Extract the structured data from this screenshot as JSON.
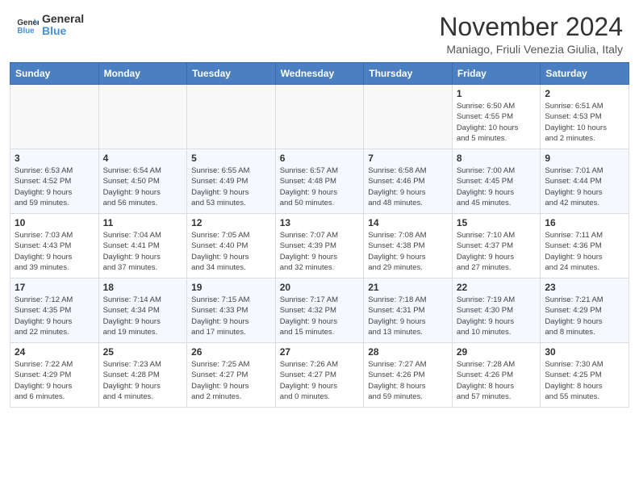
{
  "header": {
    "logo_line1": "General",
    "logo_line2": "Blue",
    "month_title": "November 2024",
    "subtitle": "Maniago, Friuli Venezia Giulia, Italy"
  },
  "weekdays": [
    "Sunday",
    "Monday",
    "Tuesday",
    "Wednesday",
    "Thursday",
    "Friday",
    "Saturday"
  ],
  "weeks": [
    [
      {
        "day": "",
        "info": ""
      },
      {
        "day": "",
        "info": ""
      },
      {
        "day": "",
        "info": ""
      },
      {
        "day": "",
        "info": ""
      },
      {
        "day": "",
        "info": ""
      },
      {
        "day": "1",
        "info": "Sunrise: 6:50 AM\nSunset: 4:55 PM\nDaylight: 10 hours\nand 5 minutes."
      },
      {
        "day": "2",
        "info": "Sunrise: 6:51 AM\nSunset: 4:53 PM\nDaylight: 10 hours\nand 2 minutes."
      }
    ],
    [
      {
        "day": "3",
        "info": "Sunrise: 6:53 AM\nSunset: 4:52 PM\nDaylight: 9 hours\nand 59 minutes."
      },
      {
        "day": "4",
        "info": "Sunrise: 6:54 AM\nSunset: 4:50 PM\nDaylight: 9 hours\nand 56 minutes."
      },
      {
        "day": "5",
        "info": "Sunrise: 6:55 AM\nSunset: 4:49 PM\nDaylight: 9 hours\nand 53 minutes."
      },
      {
        "day": "6",
        "info": "Sunrise: 6:57 AM\nSunset: 4:48 PM\nDaylight: 9 hours\nand 50 minutes."
      },
      {
        "day": "7",
        "info": "Sunrise: 6:58 AM\nSunset: 4:46 PM\nDaylight: 9 hours\nand 48 minutes."
      },
      {
        "day": "8",
        "info": "Sunrise: 7:00 AM\nSunset: 4:45 PM\nDaylight: 9 hours\nand 45 minutes."
      },
      {
        "day": "9",
        "info": "Sunrise: 7:01 AM\nSunset: 4:44 PM\nDaylight: 9 hours\nand 42 minutes."
      }
    ],
    [
      {
        "day": "10",
        "info": "Sunrise: 7:03 AM\nSunset: 4:43 PM\nDaylight: 9 hours\nand 39 minutes."
      },
      {
        "day": "11",
        "info": "Sunrise: 7:04 AM\nSunset: 4:41 PM\nDaylight: 9 hours\nand 37 minutes."
      },
      {
        "day": "12",
        "info": "Sunrise: 7:05 AM\nSunset: 4:40 PM\nDaylight: 9 hours\nand 34 minutes."
      },
      {
        "day": "13",
        "info": "Sunrise: 7:07 AM\nSunset: 4:39 PM\nDaylight: 9 hours\nand 32 minutes."
      },
      {
        "day": "14",
        "info": "Sunrise: 7:08 AM\nSunset: 4:38 PM\nDaylight: 9 hours\nand 29 minutes."
      },
      {
        "day": "15",
        "info": "Sunrise: 7:10 AM\nSunset: 4:37 PM\nDaylight: 9 hours\nand 27 minutes."
      },
      {
        "day": "16",
        "info": "Sunrise: 7:11 AM\nSunset: 4:36 PM\nDaylight: 9 hours\nand 24 minutes."
      }
    ],
    [
      {
        "day": "17",
        "info": "Sunrise: 7:12 AM\nSunset: 4:35 PM\nDaylight: 9 hours\nand 22 minutes."
      },
      {
        "day": "18",
        "info": "Sunrise: 7:14 AM\nSunset: 4:34 PM\nDaylight: 9 hours\nand 19 minutes."
      },
      {
        "day": "19",
        "info": "Sunrise: 7:15 AM\nSunset: 4:33 PM\nDaylight: 9 hours\nand 17 minutes."
      },
      {
        "day": "20",
        "info": "Sunrise: 7:17 AM\nSunset: 4:32 PM\nDaylight: 9 hours\nand 15 minutes."
      },
      {
        "day": "21",
        "info": "Sunrise: 7:18 AM\nSunset: 4:31 PM\nDaylight: 9 hours\nand 13 minutes."
      },
      {
        "day": "22",
        "info": "Sunrise: 7:19 AM\nSunset: 4:30 PM\nDaylight: 9 hours\nand 10 minutes."
      },
      {
        "day": "23",
        "info": "Sunrise: 7:21 AM\nSunset: 4:29 PM\nDaylight: 9 hours\nand 8 minutes."
      }
    ],
    [
      {
        "day": "24",
        "info": "Sunrise: 7:22 AM\nSunset: 4:29 PM\nDaylight: 9 hours\nand 6 minutes."
      },
      {
        "day": "25",
        "info": "Sunrise: 7:23 AM\nSunset: 4:28 PM\nDaylight: 9 hours\nand 4 minutes."
      },
      {
        "day": "26",
        "info": "Sunrise: 7:25 AM\nSunset: 4:27 PM\nDaylight: 9 hours\nand 2 minutes."
      },
      {
        "day": "27",
        "info": "Sunrise: 7:26 AM\nSunset: 4:27 PM\nDaylight: 9 hours\nand 0 minutes."
      },
      {
        "day": "28",
        "info": "Sunrise: 7:27 AM\nSunset: 4:26 PM\nDaylight: 8 hours\nand 59 minutes."
      },
      {
        "day": "29",
        "info": "Sunrise: 7:28 AM\nSunset: 4:26 PM\nDaylight: 8 hours\nand 57 minutes."
      },
      {
        "day": "30",
        "info": "Sunrise: 7:30 AM\nSunset: 4:25 PM\nDaylight: 8 hours\nand 55 minutes."
      }
    ]
  ]
}
